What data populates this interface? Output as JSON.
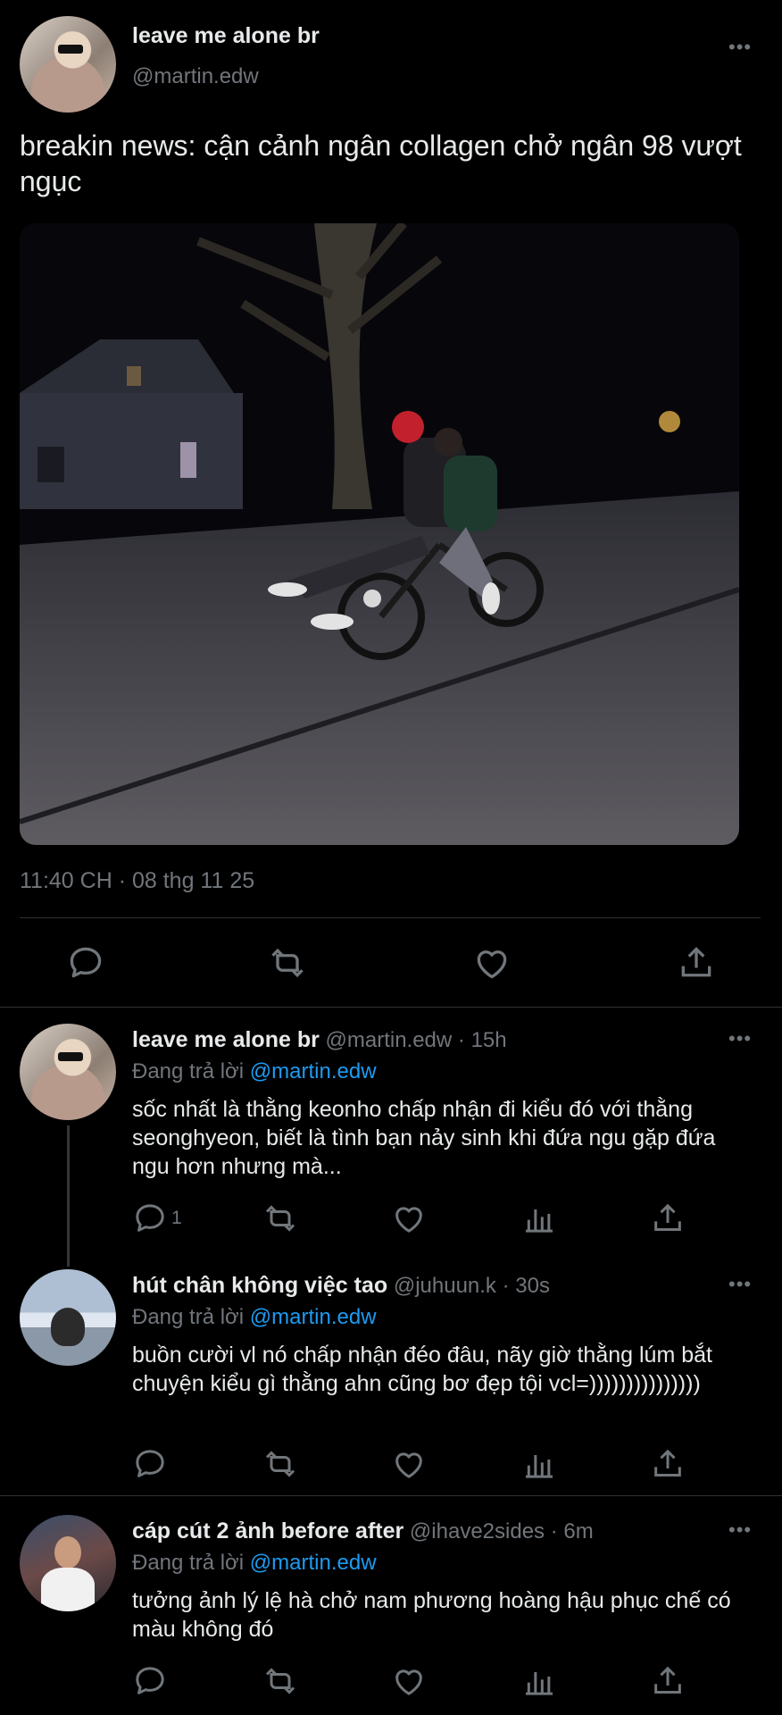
{
  "main_tweet": {
    "author_name": "leave me alone br",
    "author_handle": "@martin.edw",
    "more_label": "•••",
    "text": "breakin news: cận cảnh ngân collagen chở ngân 98 vượt ngục",
    "photo_alt": "two people riding one bicycle at night",
    "timestamp": "11:40 CH · 08 thg 11 25",
    "actions": [
      "reply-icon",
      "retweet-icon",
      "like-icon",
      "share-icon"
    ]
  },
  "replies": [
    {
      "author_name": "leave me alone br",
      "author_handle": "@martin.edw",
      "time": "· 15h",
      "replying_prefix": "Đang trả lời",
      "replying_to": "@martin.edw",
      "text": "sốc nhất là thằng keonho chấp nhận đi kiểu đó với thằng seonghyeon, biết là tình bạn nảy sinh khi đứa ngu gặp đứa ngu hơn nhưng mà...",
      "reply_count": "1"
    },
    {
      "author_name": "hút chân không việc tao",
      "author_handle": "@juhuun.k",
      "time": "· 30s",
      "replying_prefix": "Đang trả lời",
      "replying_to": "@martin.edw",
      "text": "buồn cười vl nó chấp nhận đéo đâu, nãy giờ thằng lúm bắt chuyện kiểu gì thằng ahn cũng bơ đẹp tội vcl=)))))))))))))))"
    },
    {
      "author_name": "cáp cút 2 ảnh before after",
      "author_handle": "@ihave2sides",
      "time": "· 6m",
      "replying_prefix": "Đang trả lời",
      "replying_to": "@martin.edw",
      "text": "tưởng ảnh lý lệ hà chở nam phương hoàng hậu phục chế có màu không đó"
    }
  ],
  "colors": {
    "background": "#000000",
    "text": "#e7e9ea",
    "secondary": "#71767b",
    "accent": "#1d9bf0",
    "divider": "#2f3336"
  }
}
